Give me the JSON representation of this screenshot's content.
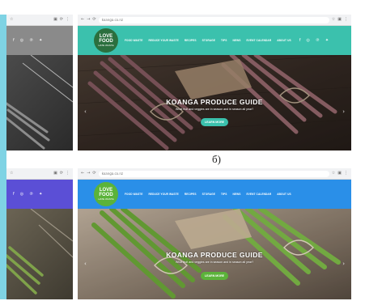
{
  "caption": "б)",
  "browser": {
    "url": "koanga.co.nz",
    "icons": [
      "back-icon",
      "forward-icon",
      "reload-icon",
      "star-icon",
      "extension-icon",
      "menu-icon"
    ]
  },
  "site": {
    "logo_line1": "LOVE FOOD",
    "logo_line2": "HATE WASTE",
    "menu": [
      "FOOD WASTE",
      "REDUCE YOUR WASTE",
      "RECIPES",
      "STORAGE",
      "TIPS",
      "NEWS",
      "EVENT CALENDAR",
      "ABOUT US"
    ],
    "social_icons": [
      "facebook-icon",
      "instagram-icon",
      "pinterest-icon",
      "twitter-icon"
    ],
    "hero_title": "KOANGA PRODUCE GUIDE",
    "hero_subtitle": "What fruit and veggies are in season and in season all year?",
    "hero_button": "LEARN MORE"
  },
  "colors": {
    "teal_header": "#3bc1ad",
    "blue_header": "#2a8fe8",
    "purple_header": "#5b4fd6",
    "left_strip": "#7fd3e4",
    "top_left_header": "#8a8a8a"
  }
}
